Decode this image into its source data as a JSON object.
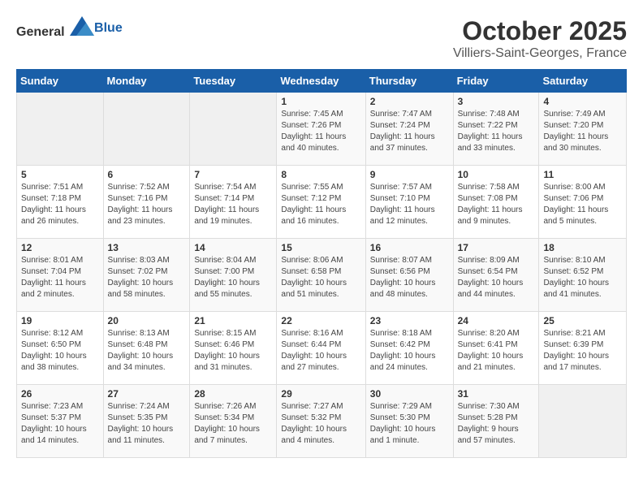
{
  "header": {
    "logo_general": "General",
    "logo_blue": "Blue",
    "month": "October 2025",
    "location": "Villiers-Saint-Georges, France"
  },
  "weekdays": [
    "Sunday",
    "Monday",
    "Tuesday",
    "Wednesday",
    "Thursday",
    "Friday",
    "Saturday"
  ],
  "weeks": [
    [
      {
        "day": "",
        "content": ""
      },
      {
        "day": "",
        "content": ""
      },
      {
        "day": "",
        "content": ""
      },
      {
        "day": "1",
        "content": "Sunrise: 7:45 AM\nSunset: 7:26 PM\nDaylight: 11 hours\nand 40 minutes."
      },
      {
        "day": "2",
        "content": "Sunrise: 7:47 AM\nSunset: 7:24 PM\nDaylight: 11 hours\nand 37 minutes."
      },
      {
        "day": "3",
        "content": "Sunrise: 7:48 AM\nSunset: 7:22 PM\nDaylight: 11 hours\nand 33 minutes."
      },
      {
        "day": "4",
        "content": "Sunrise: 7:49 AM\nSunset: 7:20 PM\nDaylight: 11 hours\nand 30 minutes."
      }
    ],
    [
      {
        "day": "5",
        "content": "Sunrise: 7:51 AM\nSunset: 7:18 PM\nDaylight: 11 hours\nand 26 minutes."
      },
      {
        "day": "6",
        "content": "Sunrise: 7:52 AM\nSunset: 7:16 PM\nDaylight: 11 hours\nand 23 minutes."
      },
      {
        "day": "7",
        "content": "Sunrise: 7:54 AM\nSunset: 7:14 PM\nDaylight: 11 hours\nand 19 minutes."
      },
      {
        "day": "8",
        "content": "Sunrise: 7:55 AM\nSunset: 7:12 PM\nDaylight: 11 hours\nand 16 minutes."
      },
      {
        "day": "9",
        "content": "Sunrise: 7:57 AM\nSunset: 7:10 PM\nDaylight: 11 hours\nand 12 minutes."
      },
      {
        "day": "10",
        "content": "Sunrise: 7:58 AM\nSunset: 7:08 PM\nDaylight: 11 hours\nand 9 minutes."
      },
      {
        "day": "11",
        "content": "Sunrise: 8:00 AM\nSunset: 7:06 PM\nDaylight: 11 hours\nand 5 minutes."
      }
    ],
    [
      {
        "day": "12",
        "content": "Sunrise: 8:01 AM\nSunset: 7:04 PM\nDaylight: 11 hours\nand 2 minutes."
      },
      {
        "day": "13",
        "content": "Sunrise: 8:03 AM\nSunset: 7:02 PM\nDaylight: 10 hours\nand 58 minutes."
      },
      {
        "day": "14",
        "content": "Sunrise: 8:04 AM\nSunset: 7:00 PM\nDaylight: 10 hours\nand 55 minutes."
      },
      {
        "day": "15",
        "content": "Sunrise: 8:06 AM\nSunset: 6:58 PM\nDaylight: 10 hours\nand 51 minutes."
      },
      {
        "day": "16",
        "content": "Sunrise: 8:07 AM\nSunset: 6:56 PM\nDaylight: 10 hours\nand 48 minutes."
      },
      {
        "day": "17",
        "content": "Sunrise: 8:09 AM\nSunset: 6:54 PM\nDaylight: 10 hours\nand 44 minutes."
      },
      {
        "day": "18",
        "content": "Sunrise: 8:10 AM\nSunset: 6:52 PM\nDaylight: 10 hours\nand 41 minutes."
      }
    ],
    [
      {
        "day": "19",
        "content": "Sunrise: 8:12 AM\nSunset: 6:50 PM\nDaylight: 10 hours\nand 38 minutes."
      },
      {
        "day": "20",
        "content": "Sunrise: 8:13 AM\nSunset: 6:48 PM\nDaylight: 10 hours\nand 34 minutes."
      },
      {
        "day": "21",
        "content": "Sunrise: 8:15 AM\nSunset: 6:46 PM\nDaylight: 10 hours\nand 31 minutes."
      },
      {
        "day": "22",
        "content": "Sunrise: 8:16 AM\nSunset: 6:44 PM\nDaylight: 10 hours\nand 27 minutes."
      },
      {
        "day": "23",
        "content": "Sunrise: 8:18 AM\nSunset: 6:42 PM\nDaylight: 10 hours\nand 24 minutes."
      },
      {
        "day": "24",
        "content": "Sunrise: 8:20 AM\nSunset: 6:41 PM\nDaylight: 10 hours\nand 21 minutes."
      },
      {
        "day": "25",
        "content": "Sunrise: 8:21 AM\nSunset: 6:39 PM\nDaylight: 10 hours\nand 17 minutes."
      }
    ],
    [
      {
        "day": "26",
        "content": "Sunrise: 7:23 AM\nSunset: 5:37 PM\nDaylight: 10 hours\nand 14 minutes."
      },
      {
        "day": "27",
        "content": "Sunrise: 7:24 AM\nSunset: 5:35 PM\nDaylight: 10 hours\nand 11 minutes."
      },
      {
        "day": "28",
        "content": "Sunrise: 7:26 AM\nSunset: 5:34 PM\nDaylight: 10 hours\nand 7 minutes."
      },
      {
        "day": "29",
        "content": "Sunrise: 7:27 AM\nSunset: 5:32 PM\nDaylight: 10 hours\nand 4 minutes."
      },
      {
        "day": "30",
        "content": "Sunrise: 7:29 AM\nSunset: 5:30 PM\nDaylight: 10 hours\nand 1 minute."
      },
      {
        "day": "31",
        "content": "Sunrise: 7:30 AM\nSunset: 5:28 PM\nDaylight: 9 hours\nand 57 minutes."
      },
      {
        "day": "",
        "content": ""
      }
    ]
  ]
}
